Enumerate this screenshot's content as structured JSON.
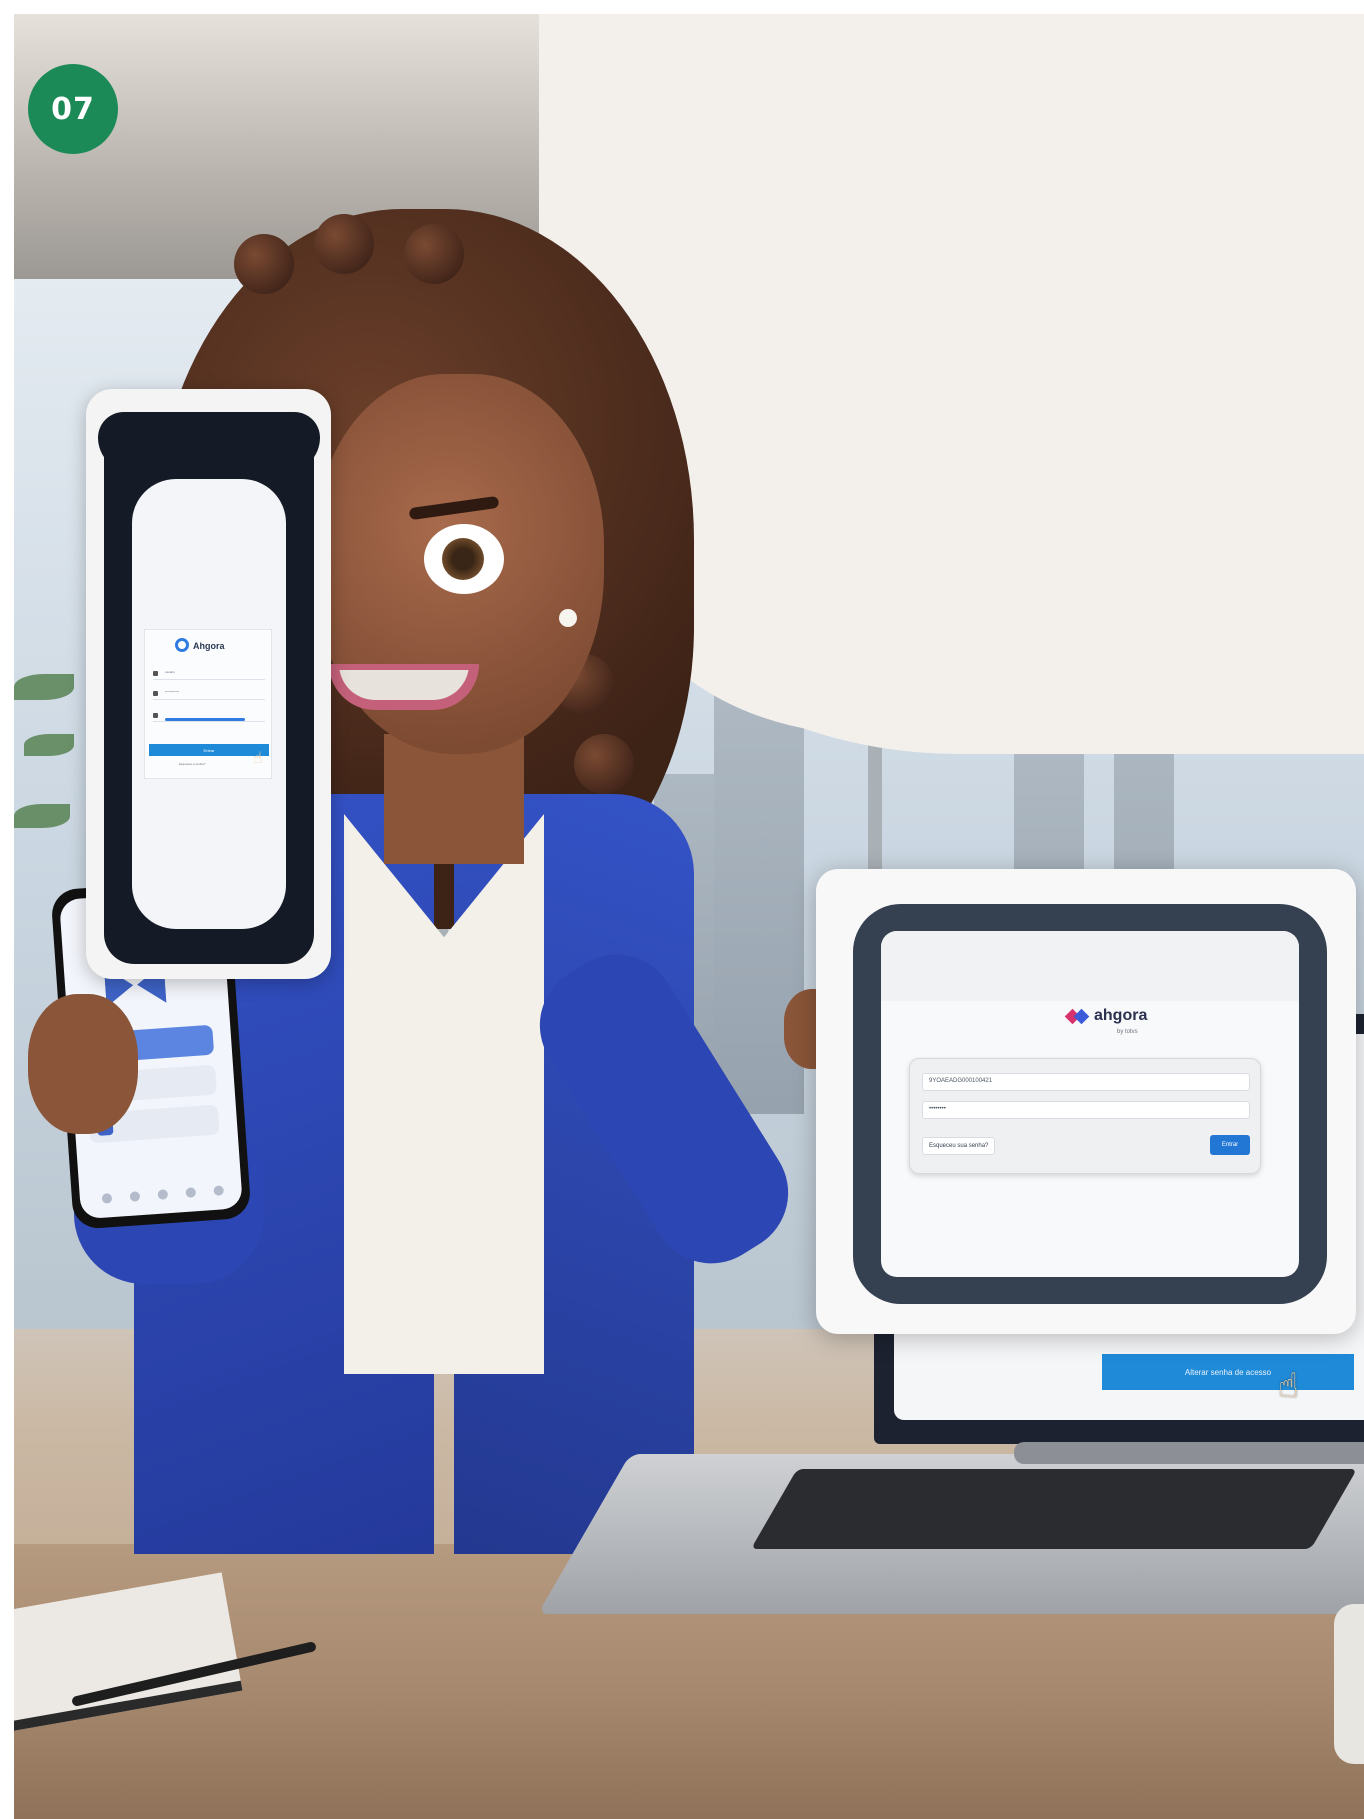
{
  "badge": {
    "number": "07",
    "color": "#1b8a57"
  },
  "phone_mockup": {
    "logo_text": "Ahgora",
    "fields": [
      {
        "icon": "user-icon",
        "text": "usuário"
      },
      {
        "icon": "lock-icon",
        "text": "************"
      },
      {
        "icon": "key-icon",
        "text": ""
      }
    ],
    "button_label": "Entrar",
    "link_text": "Esqueceu a senha?",
    "accent": "#1f8ad8"
  },
  "laptop_mockup": {
    "logo_text": "ahgora",
    "sub_text": "by totvs",
    "login_field_value": "9YOAEADG000100421",
    "password_field_value": "••••••••",
    "forgot_button_label": "Esqueceu sua senha?",
    "enter_button_label": "Entrar",
    "accent": "#2277d4"
  },
  "background_laptop": {
    "button_label": "Alterar senha de acesso",
    "accent": "#1f8ad8"
  }
}
